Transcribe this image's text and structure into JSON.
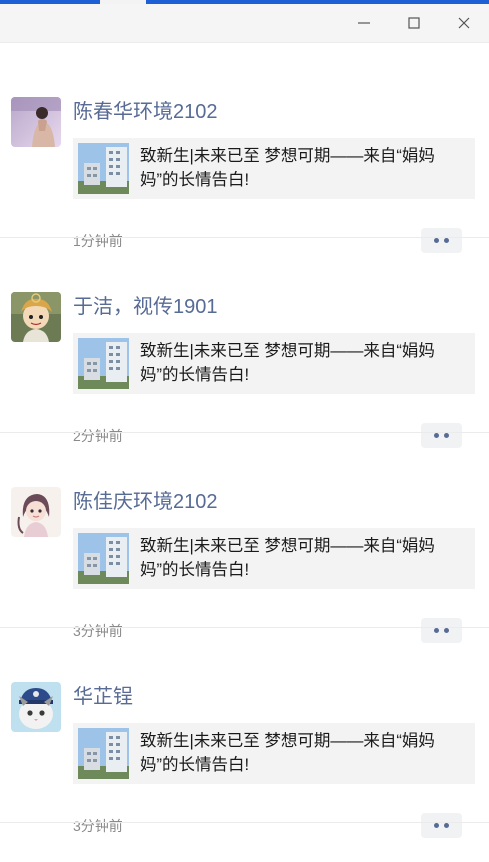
{
  "window": {
    "controls": [
      {
        "name": "minimize",
        "icon": "minimize-icon"
      },
      {
        "name": "maximize",
        "icon": "maximize-icon"
      },
      {
        "name": "close",
        "icon": "close-icon"
      }
    ]
  },
  "colors": {
    "name_link": "#576b95",
    "card_bg": "#f3f3f3",
    "time_text": "#8a8a8a",
    "accent_strip": "#1f5fd6"
  },
  "moments": [
    {
      "author": "陈春华环境2102",
      "share_title": "致新生|未来已至 梦想可期——来自“娟妈妈”的长情告白!",
      "time": "1分钟前"
    },
    {
      "author": "于洁，视传1901",
      "share_title": "致新生|未来已至 梦想可期——来自“娟妈妈”的长情告白!",
      "time": "2分钟前"
    },
    {
      "author": "陈佳庆环境2102",
      "share_title": "致新生|未来已至 梦想可期——来自“娟妈妈”的长情告白!",
      "time": "3分钟前"
    },
    {
      "author": "华芷锃",
      "share_title": "致新生|未来已至 梦想可期——来自“娟妈妈”的长情告白!",
      "time": "3分钟前"
    }
  ]
}
